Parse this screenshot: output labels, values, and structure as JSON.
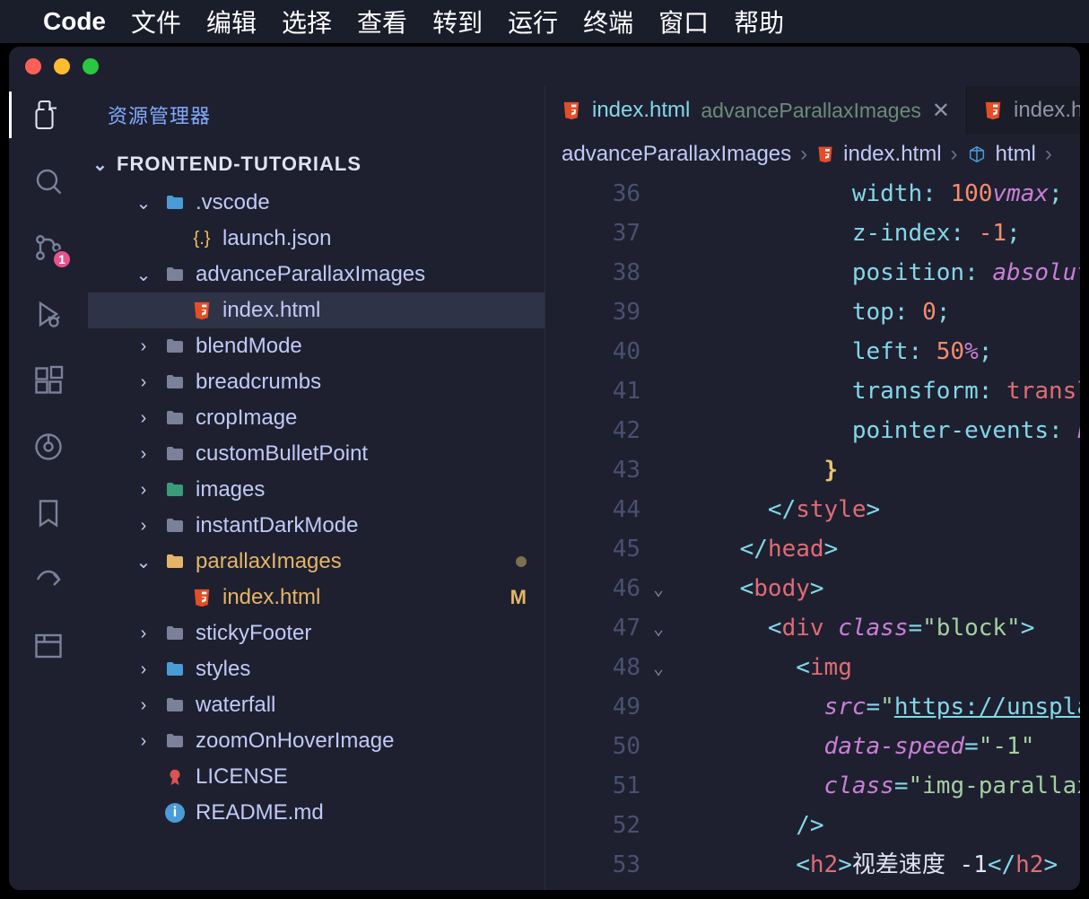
{
  "menubar": {
    "app": "Code",
    "items": [
      "文件",
      "编辑",
      "选择",
      "查看",
      "转到",
      "运行",
      "终端",
      "窗口",
      "帮助"
    ]
  },
  "activity": {
    "scm_badge": "1"
  },
  "sidebar": {
    "title": "资源管理器",
    "section": "FRONTEND-TUTORIALS",
    "tree": [
      {
        "type": "folder",
        "name": ".vscode",
        "open": true,
        "indent": 1,
        "icon": "css"
      },
      {
        "type": "file",
        "name": "launch.json",
        "indent": 2,
        "icon": "json"
      },
      {
        "type": "folder",
        "name": "advanceParallaxImages",
        "open": true,
        "indent": 1
      },
      {
        "type": "file",
        "name": "index.html",
        "indent": 2,
        "icon": "html",
        "selected": true
      },
      {
        "type": "folder",
        "name": "blendMode",
        "open": false,
        "indent": 1
      },
      {
        "type": "folder",
        "name": "breadcrumbs",
        "open": false,
        "indent": 1
      },
      {
        "type": "folder",
        "name": "cropImage",
        "open": false,
        "indent": 1
      },
      {
        "type": "folder",
        "name": "customBulletPoint",
        "open": false,
        "indent": 1
      },
      {
        "type": "folder",
        "name": "images",
        "open": false,
        "indent": 1,
        "icon": "img"
      },
      {
        "type": "folder",
        "name": "instantDarkMode",
        "open": false,
        "indent": 1
      },
      {
        "type": "folder",
        "name": "parallaxImages",
        "open": true,
        "indent": 1,
        "modified": true,
        "dot": true
      },
      {
        "type": "file",
        "name": "index.html",
        "indent": 2,
        "icon": "html",
        "modified": true,
        "m": true
      },
      {
        "type": "folder",
        "name": "stickyFooter",
        "open": false,
        "indent": 1
      },
      {
        "type": "folder",
        "name": "styles",
        "open": false,
        "indent": 1,
        "icon": "css"
      },
      {
        "type": "folder",
        "name": "waterfall",
        "open": false,
        "indent": 1
      },
      {
        "type": "folder",
        "name": "zoomOnHoverImage",
        "open": false,
        "indent": 1
      },
      {
        "type": "file",
        "name": "LICENSE",
        "indent": 1,
        "icon": "license"
      },
      {
        "type": "file",
        "name": "README.md",
        "indent": 1,
        "icon": "info"
      }
    ]
  },
  "tabs": [
    {
      "icon": "html",
      "name": "index.html",
      "sub": "advanceParallaxImages",
      "active": true,
      "close": true
    },
    {
      "icon": "html",
      "name": "index.h",
      "active": false
    }
  ],
  "breadcrumb": [
    "advanceParallaxImages",
    "index.html",
    "html"
  ],
  "code": {
    "startLine": 36,
    "lines": [
      {
        "n": 36,
        "html": "            <span class='c-prop'>width</span><span class='c-punc'>:</span> <span class='c-num'>100</span><span class='c-unit'>vmax</span><span class='c-punc'>;</span>"
      },
      {
        "n": 37,
        "html": "            <span class='c-prop'>z-index</span><span class='c-punc'>:</span> <span class='c-num'>-1</span><span class='c-punc'>;</span>"
      },
      {
        "n": 38,
        "html": "            <span class='c-prop'>position</span><span class='c-punc'>:</span> <span class='c-kw'>absolute</span><span class='c-punc'>;</span>"
      },
      {
        "n": 39,
        "html": "            <span class='c-prop'>top</span><span class='c-punc'>:</span> <span class='c-num'>0</span><span class='c-punc'>;</span>"
      },
      {
        "n": 40,
        "html": "            <span class='c-prop'>left</span><span class='c-punc'>:</span> <span class='c-num'>50</span><span class='c-unit'>%</span><span class='c-punc'>;</span>"
      },
      {
        "n": 41,
        "html": "            <span class='c-prop'>transform</span><span class='c-punc'>:</span> <span class='c-tag'>translate</span>"
      },
      {
        "n": 42,
        "html": "            <span class='c-prop'>pointer-events</span><span class='c-punc'>:</span> <span class='c-kw'>none</span>"
      },
      {
        "n": 43,
        "html": "          <span class='c-curly'>}</span>"
      },
      {
        "n": 44,
        "html": "      <span class='c-br'>&lt;/</span><span class='c-tag'>style</span><span class='c-br'>&gt;</span>"
      },
      {
        "n": 45,
        "html": "    <span class='c-br'>&lt;/</span><span class='c-tag'>head</span><span class='c-br'>&gt;</span>"
      },
      {
        "n": 46,
        "fold": true,
        "html": "    <span class='c-br'>&lt;</span><span class='c-tag'>body</span><span class='c-br'>&gt;</span>"
      },
      {
        "n": 47,
        "fold": true,
        "html": "      <span class='c-br'>&lt;</span><span class='c-tag'>div</span> <span class='c-attr'>class</span><span class='c-punc'>=</span><span class='c-str'>\"block\"</span><span class='c-br'>&gt;</span>"
      },
      {
        "n": 48,
        "fold": true,
        "html": "        <span class='c-br'>&lt;</span><span class='c-tag'>img</span>"
      },
      {
        "n": 49,
        "html": "          <span class='c-attr'>src</span><span class='c-punc'>=</span><span class='c-str'>\"</span><span class='c-link'>https://unsplas</span>"
      },
      {
        "n": 50,
        "html": "          <span class='c-attr'>data-speed</span><span class='c-punc'>=</span><span class='c-str'>\"-1\"</span>"
      },
      {
        "n": 51,
        "html": "          <span class='c-attr'>class</span><span class='c-punc'>=</span><span class='c-str'>\"img-parallax\"</span>"
      },
      {
        "n": 52,
        "html": "        <span class='c-br'>/&gt;</span>"
      },
      {
        "n": 53,
        "html": "        <span class='c-br'>&lt;</span><span class='c-tag'>h2</span><span class='c-br'>&gt;</span><span class='c-text'>视差速度 -1</span><span class='c-br'>&lt;/</span><span class='c-tag'>h2</span><span class='c-br'>&gt;</span>"
      }
    ]
  }
}
